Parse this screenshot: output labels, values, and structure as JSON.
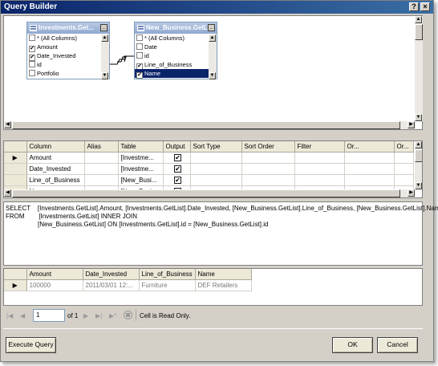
{
  "window": {
    "title": "Query Builder",
    "help_glyph": "?",
    "close_glyph": "×"
  },
  "diagram": {
    "tables": [
      {
        "name": "Investments.Get...",
        "columns": [
          {
            "label": "* (All Columns)",
            "checked": false,
            "selected": false
          },
          {
            "label": "Amount",
            "checked": true,
            "selected": false
          },
          {
            "label": "Date_Invested",
            "checked": true,
            "selected": false
          },
          {
            "label": "id",
            "checked": false,
            "selected": false
          },
          {
            "label": "Portfolio",
            "checked": false,
            "selected": false
          }
        ]
      },
      {
        "name": "New_Business.GetL...",
        "columns": [
          {
            "label": "* (All Columns)",
            "checked": false,
            "selected": false
          },
          {
            "label": "Date",
            "checked": false,
            "selected": false
          },
          {
            "label": "id",
            "checked": false,
            "selected": false
          },
          {
            "label": "Line_of_Business",
            "checked": true,
            "selected": false
          },
          {
            "label": "Name",
            "checked": true,
            "selected": true
          }
        ]
      }
    ]
  },
  "criteria": {
    "headers": [
      "Column",
      "Alias",
      "Table",
      "Output",
      "Sort Type",
      "Sort Order",
      "Filter",
      "Or...",
      "Or..."
    ],
    "rows": [
      {
        "column": "Amount",
        "alias": "",
        "table": "[Investme...",
        "output": true,
        "current": true
      },
      {
        "column": "Date_Invested",
        "alias": "",
        "table": "[Investme...",
        "output": true,
        "current": false
      },
      {
        "column": "Line_of_Business",
        "alias": "",
        "table": "[New_Busi...",
        "output": true,
        "current": false
      },
      {
        "column": "Name",
        "alias": "",
        "table": "[New_Busi...",
        "output": true,
        "current": false
      }
    ]
  },
  "sql": {
    "lines": [
      "SELECT    [Investments.GetList].Amount, [Investments.GetList].Date_Invested, [New_Business.GetList].Line_of_Business, [New_Business.GetList].Name",
      "FROM        [Investments.GetList] INNER JOIN",
      "                  [New_Business.GetList] ON [Investments.GetList].id = [New_Business.GetList].id"
    ]
  },
  "results": {
    "headers": [
      "Amount",
      "Date_Invested",
      "Line_of_Business",
      "Name"
    ],
    "rows": [
      {
        "cells": [
          "100000",
          "2011/03/01 12:...",
          "Furniture",
          "DEF Retailers"
        ]
      }
    ]
  },
  "navigator": {
    "position": "1",
    "of_label": "of 1",
    "status": "Cell is Read Only."
  },
  "buttons": {
    "execute": "Execute Query",
    "ok": "OK",
    "cancel": "Cancel"
  },
  "colors": {
    "title_bar": "#0a246a",
    "selection": "#0a246a",
    "dialog_face": "#d4d0c8"
  }
}
